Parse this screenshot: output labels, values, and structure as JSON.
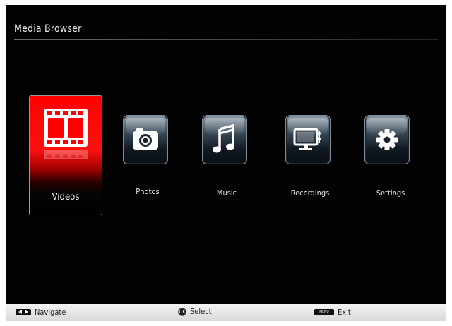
{
  "header": {
    "title": "Media Browser"
  },
  "menu": {
    "items": [
      {
        "label": "Videos",
        "icon": "film-strip-icon",
        "selected": true
      },
      {
        "label": "Photos",
        "icon": "camera-icon",
        "selected": false
      },
      {
        "label": "Music",
        "icon": "music-note-icon",
        "selected": false
      },
      {
        "label": "Recordings",
        "icon": "monitor-recordings-icon",
        "selected": false
      },
      {
        "label": "Settings",
        "icon": "gear-icon",
        "selected": false
      }
    ]
  },
  "footer": {
    "navigate_label": "Navigate",
    "select_label": "Select",
    "exit_label": "Exit",
    "ok_key": "OK",
    "menu_key": "MENU"
  },
  "colors": {
    "selected_highlight": "#ff0000",
    "background": "#020202",
    "footer_bar": "#e8e8e8",
    "tile_accent": "#4a6a88"
  }
}
